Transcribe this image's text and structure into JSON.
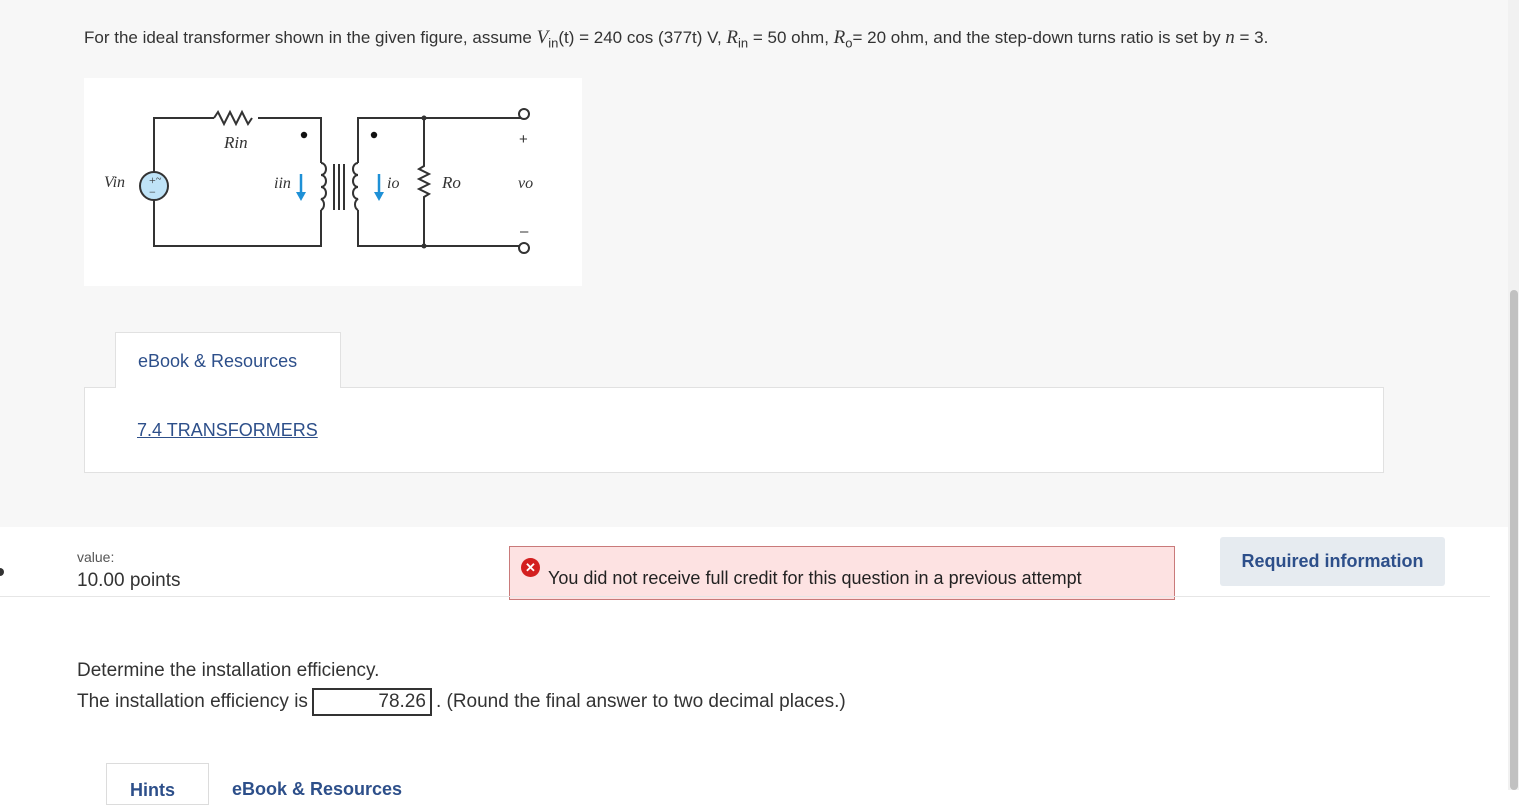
{
  "question": {
    "prompt_text_1": "For the ideal transformer shown in the given figure, assume ",
    "vin_symbol": "V",
    "vin_sub": "in",
    "vin_expr": "(t) = 240 cos (377t) V,  ",
    "rin_symbol": "R",
    "rin_sub": "in",
    "rin_value": " = 50 ohm, ",
    "ro_symbol": "R",
    "ro_sub": "o",
    "ro_value": "= 20 ohm, and the step-down turns ratio is set by ",
    "n_symbol": "n",
    "n_value": " = 3."
  },
  "figure": {
    "labels": {
      "rin": "Rin",
      "vin": "Vin",
      "iin": "iin",
      "io": "io",
      "ro": "Ro",
      "vo": "vo",
      "plus": "+",
      "minus": "–"
    }
  },
  "resources": {
    "tab_label": "eBook & Resources",
    "link_text": "7.4 TRANSFORMERS"
  },
  "score": {
    "value_label": "value:",
    "points": "10.00 points"
  },
  "alert": {
    "icon": "✕",
    "text": "You did not receive full credit for this question in a previous attempt"
  },
  "required_button": "Required information",
  "part": {
    "instruction": "Determine the installation efficiency.",
    "answer_prefix": "The installation efficiency is",
    "answer_value": "78.26",
    "answer_suffix": ". (Round the final answer to two decimal places.)"
  },
  "bottom_tabs": {
    "hints": "Hints",
    "ebook": "eBook & Resources"
  },
  "colors": {
    "link": "#2d4f8a",
    "alert_bg": "#fde2e2",
    "alert_border": "#c97a7a",
    "alert_icon": "#d32020",
    "source_fill": "#bfe3f7",
    "current_arrow": "#1e90d6"
  }
}
